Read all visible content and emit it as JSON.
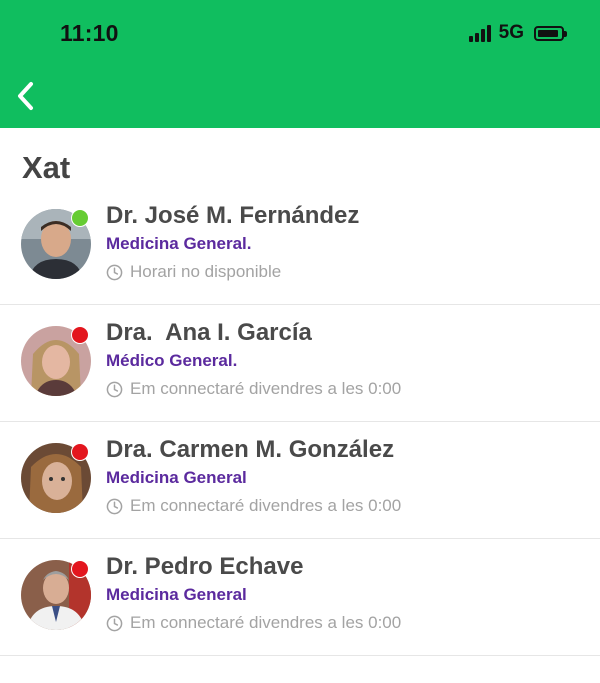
{
  "status_bar": {
    "time": "11:10",
    "network": "5G",
    "signal_bars": 4
  },
  "header": {
    "back_icon": "chevron-left-icon",
    "background_color": "#10BE5F"
  },
  "page": {
    "title": "Xat"
  },
  "contacts": [
    {
      "name": "Dr. José M. Fernández",
      "specialty": "Medicina General.",
      "status": "online",
      "status_color": "#66CC33",
      "schedule": "Horari no disponible"
    },
    {
      "name": "Dra.  Ana I. García",
      "specialty": "Médico General.",
      "status": "offline",
      "status_color": "#E3161E",
      "schedule": "Em connectaré divendres a les 0:00"
    },
    {
      "name": "Dra. Carmen M. González",
      "specialty": "Medicina General",
      "status": "offline",
      "status_color": "#E3161E",
      "schedule": "Em connectaré divendres a les 0:00"
    },
    {
      "name": "Dr. Pedro Echave",
      "specialty": "Medicina General",
      "status": "offline",
      "status_color": "#E3161E",
      "schedule": "Em connectaré divendres a les 0:00"
    }
  ]
}
